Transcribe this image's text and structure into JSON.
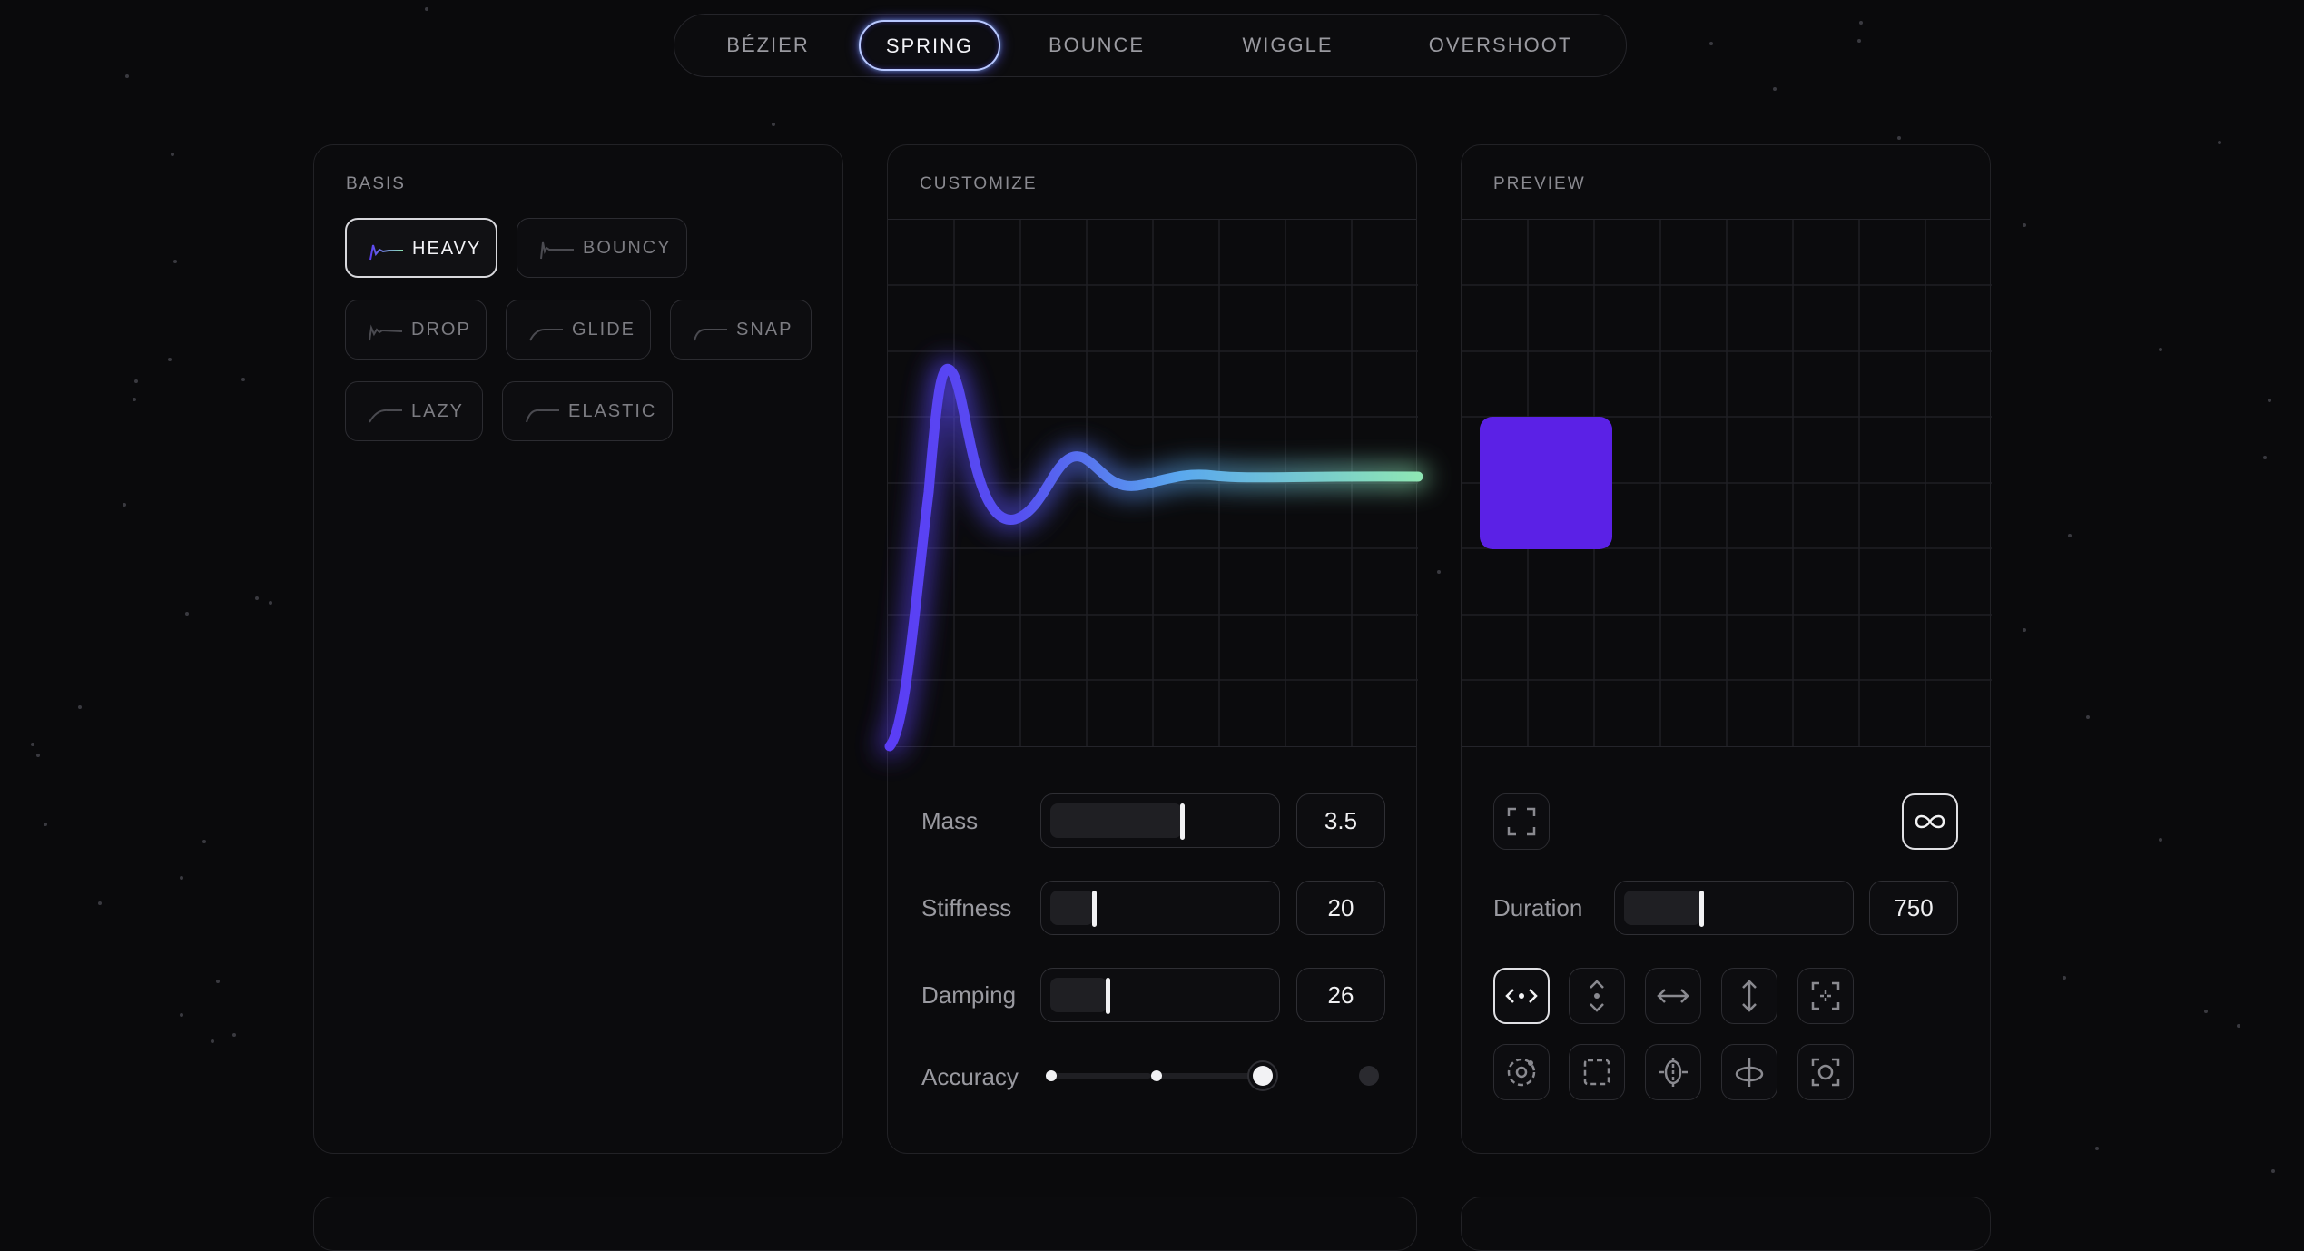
{
  "tabs": [
    {
      "label": "BÉZIER"
    },
    {
      "label": "SPRING",
      "active": true
    },
    {
      "label": "BOUNCE"
    },
    {
      "label": "WIGGLE"
    },
    {
      "label": "OVERSHOOT"
    }
  ],
  "basis": {
    "title": "BASIS",
    "presets": [
      {
        "label": "HEAVY",
        "active": true
      },
      {
        "label": "BOUNCY"
      },
      {
        "label": "DROP"
      },
      {
        "label": "GLIDE"
      },
      {
        "label": "SNAP"
      },
      {
        "label": "LAZY"
      },
      {
        "label": "ELASTIC"
      }
    ]
  },
  "customize": {
    "title": "CUSTOMIZE",
    "mass": {
      "label": "Mass",
      "value": "3.5",
      "fraction": 0.6
    },
    "stiffness": {
      "label": "Stiffness",
      "value": "20",
      "fraction": 0.2
    },
    "damping": {
      "label": "Damping",
      "value": "26",
      "fraction": 0.26
    },
    "accuracy": {
      "label": "Accuracy",
      "level": 3,
      "levels": 4
    }
  },
  "preview": {
    "title": "PREVIEW",
    "duration": {
      "label": "Duration",
      "value": "750",
      "fraction": 0.35
    },
    "box_color": "#5b21e6",
    "transforms": [
      {
        "icon": "move-horizontal-icon",
        "active": true
      },
      {
        "icon": "move-vertical-icon"
      },
      {
        "icon": "stretch-horizontal-icon"
      },
      {
        "icon": "stretch-vertical-icon"
      },
      {
        "icon": "focus-scale-icon"
      },
      {
        "icon": "rotate-icon"
      },
      {
        "icon": "fade-icon"
      },
      {
        "icon": "flip-horizontal-icon"
      },
      {
        "icon": "flip-vertical-icon"
      },
      {
        "icon": "camera-focus-icon"
      }
    ],
    "fullscreen_icon": "fullscreen-icon",
    "loop_icon": "infinity-loop-icon"
  },
  "colors": {
    "curve_start": "#5b3df5",
    "curve_mid": "#5aa8ee",
    "curve_end": "#8ee6b4",
    "accent": "#5b21e6"
  }
}
